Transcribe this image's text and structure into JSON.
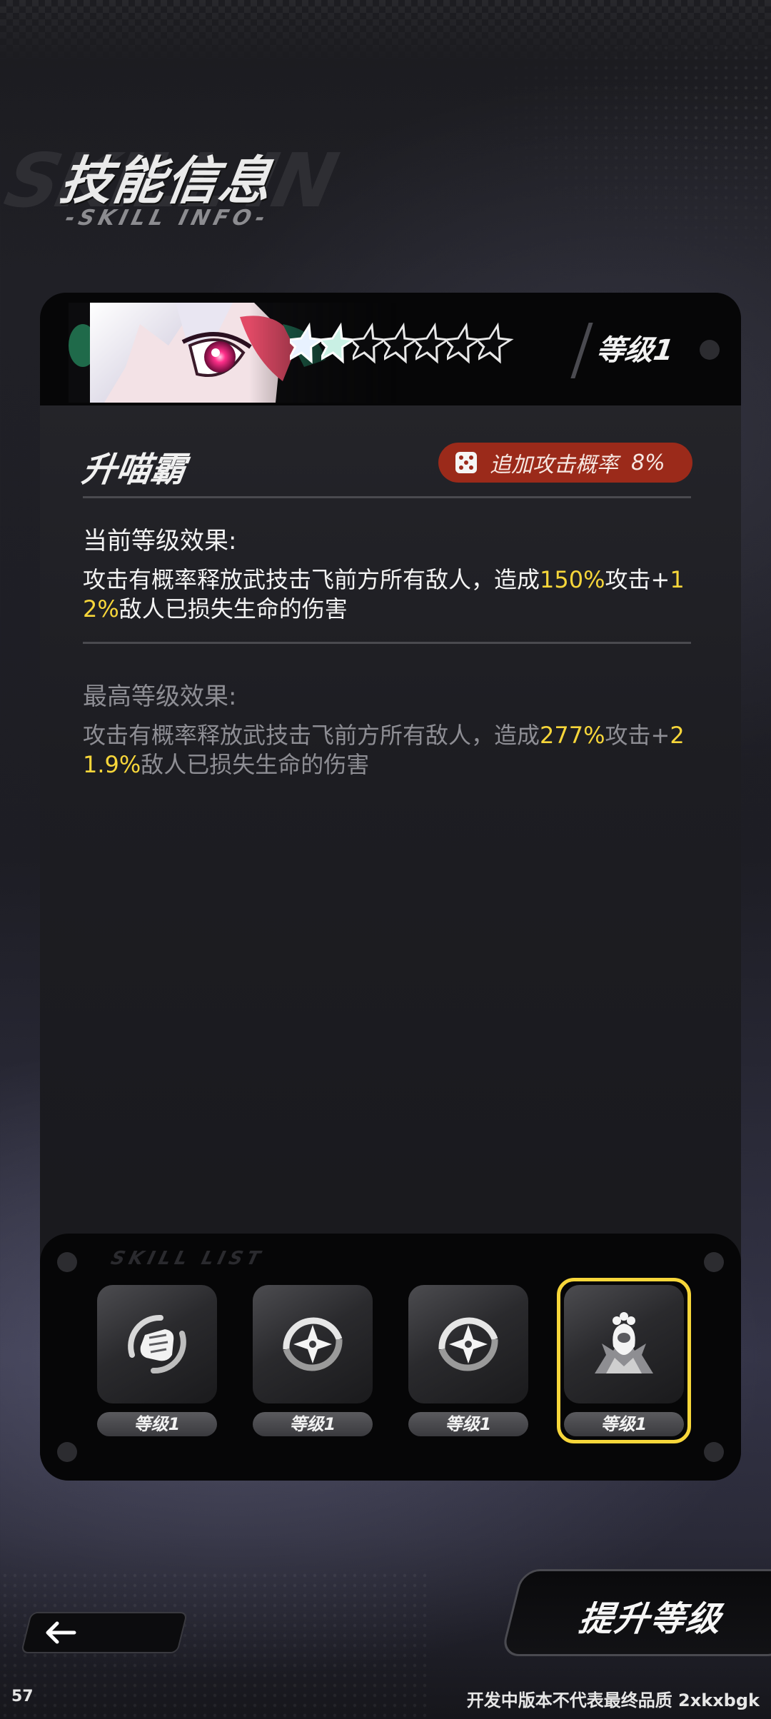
{
  "header": {
    "title": "技能信息",
    "subtitle": "-SKILL INFO-"
  },
  "card": {
    "stars_total": 7,
    "stars_filled": 2,
    "level_label": "等级1",
    "skill_name": "升喵霸",
    "chance_badge": {
      "label": "追加攻击概率",
      "value": "8%"
    },
    "current": {
      "title": "当前等级效果:",
      "text_before": "攻击有概率释放武技击飞前方所有敌人，造成",
      "hl1": "150%",
      "text_mid": "攻击+",
      "hl2": "12%",
      "text_after": "敌人已损失生命的伤害"
    },
    "max": {
      "title": "最高等级效果:",
      "text_before": "攻击有概率释放武技击飞前方所有敌人，造成",
      "hl1": "277%",
      "text_mid": "攻击+",
      "hl2": "21.9%",
      "text_after": "敌人已损失生命的伤害"
    }
  },
  "skill_bar": {
    "label": "SKILL LIST",
    "slots": [
      {
        "icon": "fist-swirl-icon",
        "level": "等级1",
        "selected": false
      },
      {
        "icon": "shuriken-icon",
        "level": "等级1",
        "selected": false
      },
      {
        "icon": "shuriken-icon",
        "level": "等级1",
        "selected": false
      },
      {
        "icon": "cat-paw-burst-icon",
        "level": "等级1",
        "selected": true
      }
    ]
  },
  "controls": {
    "back_icon": "back-arrow-icon",
    "upgrade_label": "提升等级"
  },
  "footer": {
    "left": "57",
    "right": "开发中版本不代表最终品质 2xkxbgk"
  },
  "colors": {
    "highlight": "#f7d63a",
    "badge": "#9b2a1a",
    "selected_frame": "#f7d63a"
  }
}
